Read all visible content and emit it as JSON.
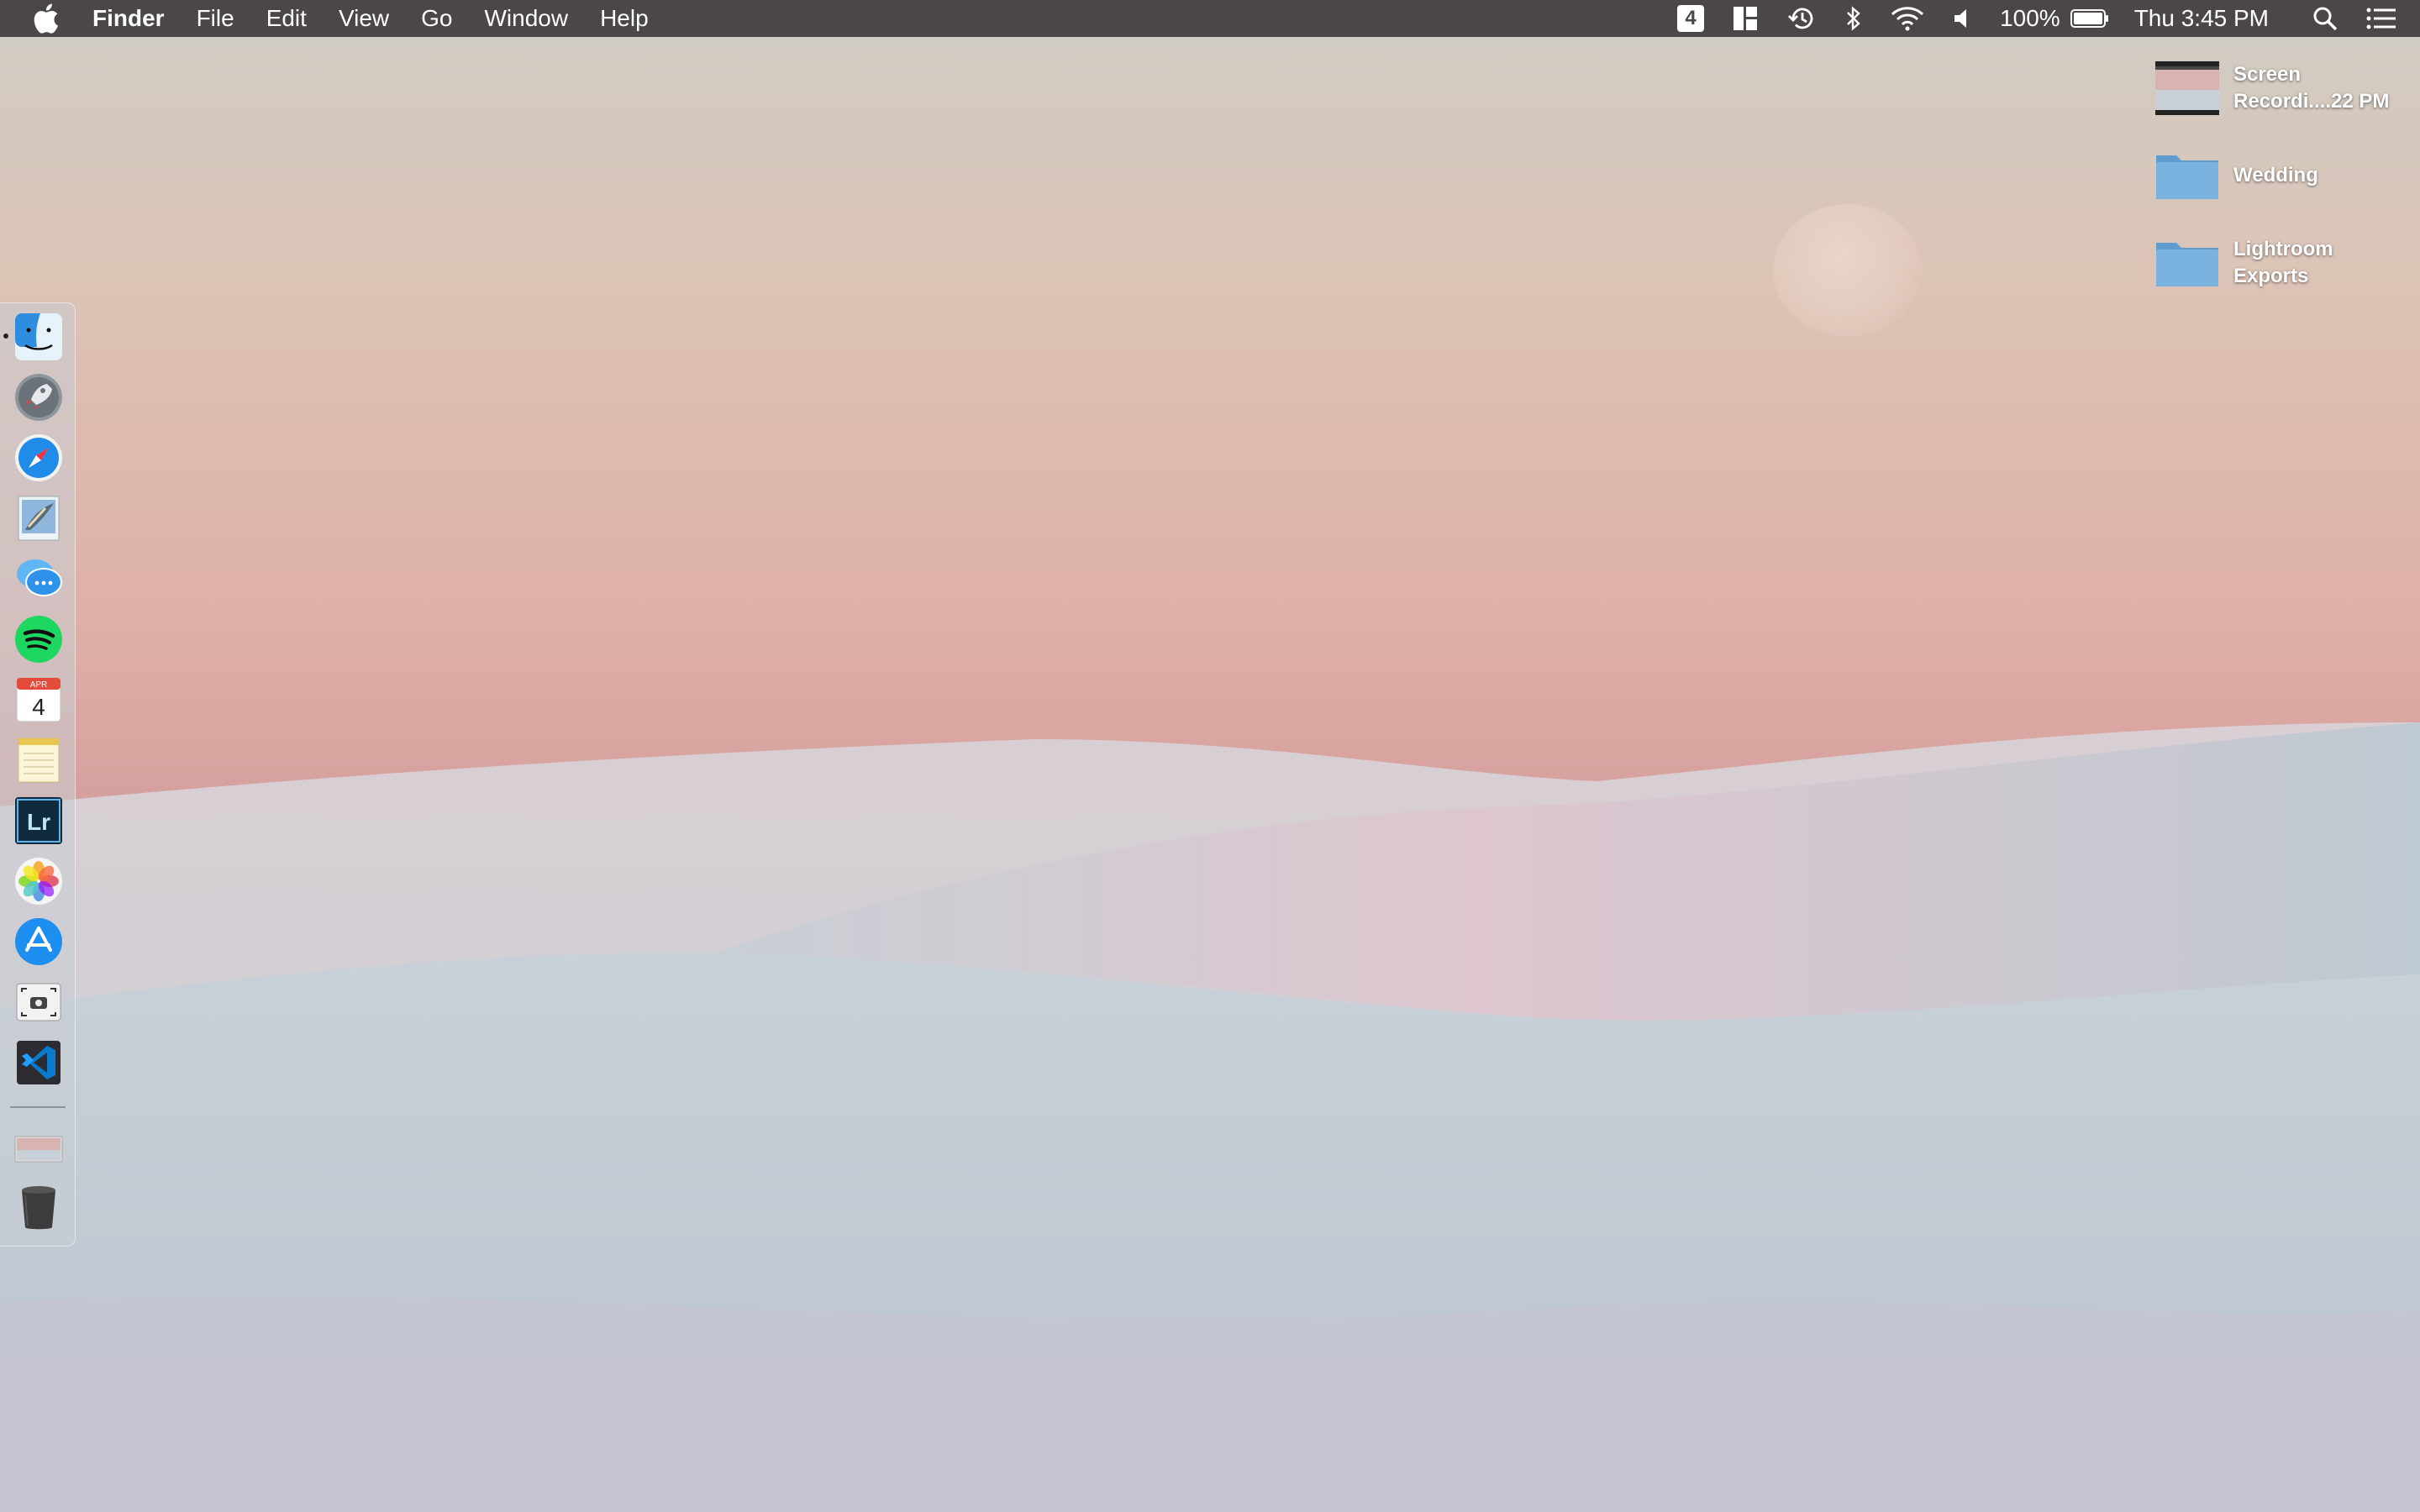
{
  "menubar": {
    "app_name": "Finder",
    "menus": [
      "File",
      "Edit",
      "View",
      "Go",
      "Window",
      "Help"
    ],
    "status": {
      "spaces_number": "4",
      "battery_percent": "100%",
      "clock": "Thu 3:45 PM"
    }
  },
  "desktop_items": [
    {
      "label": "Screen Recordi....22 PM",
      "line1": "Screen",
      "line2": "Recordi....22 PM",
      "kind": "video-thumbnail"
    },
    {
      "label": "Wedding",
      "line1": "Wedding",
      "line2": "",
      "kind": "folder"
    },
    {
      "label": "Lightroom Exports",
      "line1": "Lightroom",
      "line2": "Exports",
      "kind": "folder"
    }
  ],
  "dock": {
    "apps": [
      {
        "name": "Finder",
        "icon": "finder-icon",
        "running": true
      },
      {
        "name": "Launchpad",
        "icon": "launchpad-icon",
        "running": false
      },
      {
        "name": "Safari",
        "icon": "safari-icon",
        "running": false
      },
      {
        "name": "Mail",
        "icon": "mail-icon",
        "running": false
      },
      {
        "name": "Messages",
        "icon": "messages-icon",
        "running": false
      },
      {
        "name": "Spotify",
        "icon": "spotify-icon",
        "running": false
      },
      {
        "name": "Calendar",
        "icon": "calendar-icon",
        "running": false
      },
      {
        "name": "Notes",
        "icon": "notes-icon",
        "running": false
      },
      {
        "name": "Lightroom",
        "icon": "lightroom-icon",
        "running": false
      },
      {
        "name": "Photos",
        "icon": "photos-icon",
        "running": false
      },
      {
        "name": "App Store",
        "icon": "app-store-icon",
        "running": false
      },
      {
        "name": "Screenshot",
        "icon": "screenshot-icon",
        "running": false
      },
      {
        "name": "Visual Studio Code",
        "icon": "vscode-icon",
        "running": false
      }
    ],
    "calendar_month": "APR",
    "calendar_day": "4",
    "lightroom_text": "Lr",
    "others": [
      {
        "name": "Downloads stack",
        "icon": "stack-thumbnail-icon"
      },
      {
        "name": "Trash",
        "icon": "trash-icon"
      }
    ]
  },
  "colors": {
    "menubar": "#4b4747",
    "folder": "#6fa8d8",
    "sky_top": "#cfcdc6",
    "sky_pink": "#d9a4a0",
    "sand": "#c4ccd3"
  }
}
